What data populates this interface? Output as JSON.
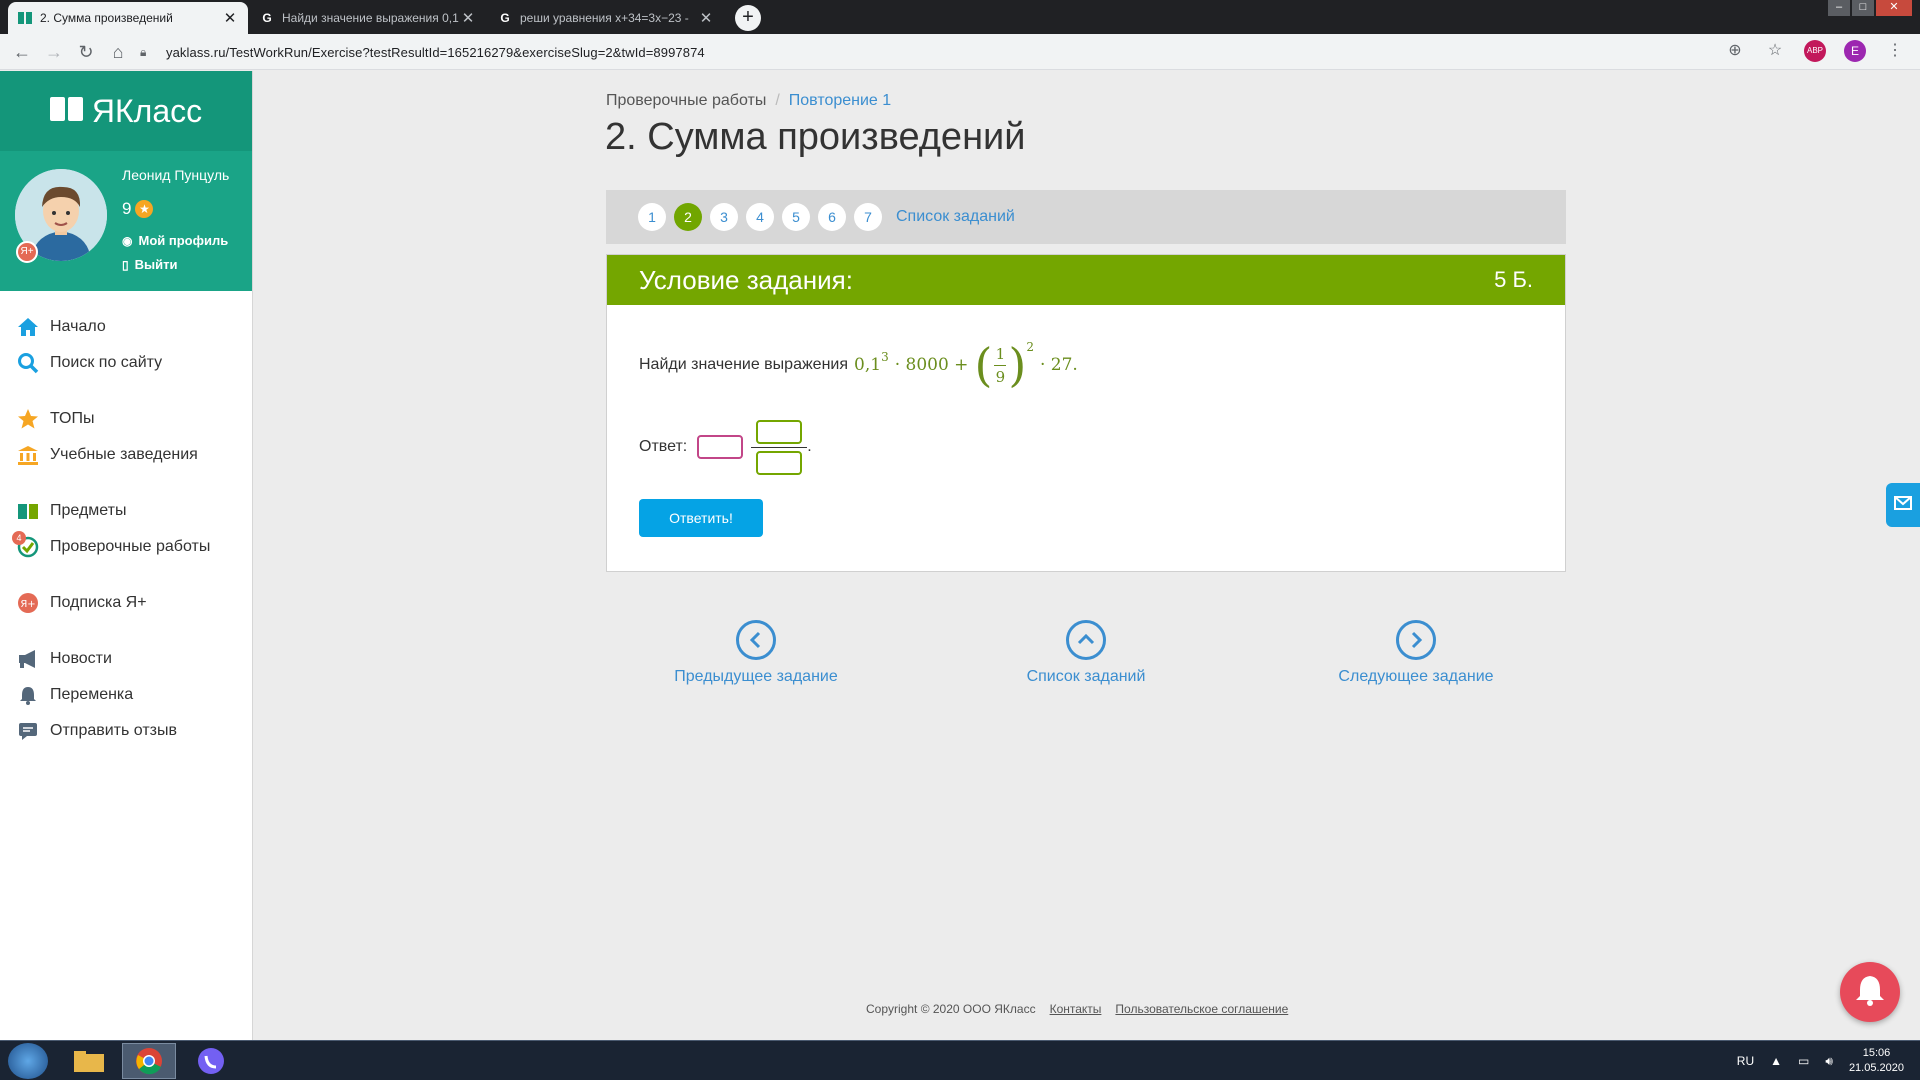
{
  "browser": {
    "tabs": [
      {
        "title": "2. Сумма произведений",
        "active": true
      },
      {
        "title": "Найди значение выражения 0,1",
        "active": false
      },
      {
        "title": "реши уравнения x+34=3x−23 -",
        "active": false
      }
    ],
    "new_tab_label": "+",
    "url": "yaklass.ru/TestWorkRun/Exercise?testResultId=165216279&exerciseSlug=2&twId=8997874",
    "profile_initial": "E"
  },
  "sidebar": {
    "logo_text": "ЯКласс",
    "user": {
      "name": "Леонид Пунцуль",
      "points": "9",
      "profile_link": "Мой профиль",
      "logout_link": "Выйти",
      "badge": "Я+"
    },
    "menu": [
      {
        "label": "Начало",
        "icon": "home-icon"
      },
      {
        "label": "Поиск по сайту",
        "icon": "search-icon"
      },
      {
        "label": "ТОПы",
        "icon": "star-icon"
      },
      {
        "label": "Учебные заведения",
        "icon": "school-icon"
      },
      {
        "label": "Предметы",
        "icon": "books-icon"
      },
      {
        "label": "Проверочные работы",
        "icon": "check-icon"
      },
      {
        "label": "Подписка Я+",
        "icon": "ya-plus-icon"
      },
      {
        "label": "Новости",
        "icon": "megaphone-icon"
      },
      {
        "label": "Переменка",
        "icon": "bell-icon"
      },
      {
        "label": "Отправить отзыв",
        "icon": "feedback-icon"
      }
    ],
    "check_badge": "4"
  },
  "breadcrumb": {
    "root": "Проверочные работы",
    "current": "Повторение 1"
  },
  "page": {
    "title": "2. Сумма произведений"
  },
  "pager": {
    "pages": [
      "1",
      "2",
      "3",
      "4",
      "5",
      "6",
      "7"
    ],
    "active": "2",
    "tasks_link": "Список заданий"
  },
  "task": {
    "header": "Условие задания:",
    "points": "5 Б.",
    "question_text": "Найди значение выражения",
    "math": {
      "base": "0,1",
      "exp": "3",
      "mid": "· 8000 +",
      "num": "1",
      "den": "9",
      "exp2": "2",
      "tail": "· 27."
    },
    "answer_label": "Ответ:",
    "submit_label": "Ответить!"
  },
  "bottom_nav": {
    "prev": "Предыдущее задание",
    "list": "Список заданий",
    "next": "Следующее задание"
  },
  "footer": {
    "copyright": "Copyright © 2020 ООО ЯКласс",
    "contacts": "Контакты",
    "agreement": "Пользовательское соглашение"
  },
  "taskbar": {
    "lang": "RU",
    "time": "15:06",
    "date": "21.05.2020"
  },
  "colors": {
    "brand_green": "#14967a",
    "task_green": "#74a600",
    "link_blue": "#3b8ed0",
    "button_blue": "#05a3e5"
  }
}
